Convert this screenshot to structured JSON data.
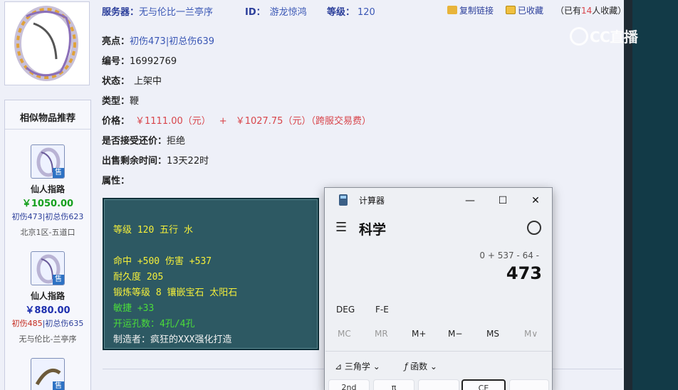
{
  "header": {
    "server_label": "服务器：",
    "server_value": "无与伦比一兰亭序",
    "id_label": "ID：",
    "id_value": "游龙惊鸿",
    "level_label": "等级：",
    "level_value": "120",
    "copy_link": "复制链接",
    "favorited": "已收藏",
    "fav_count_prefix": "（已有",
    "fav_count": "14",
    "fav_count_suffix": "人收藏）"
  },
  "details": {
    "highlight_label": "亮点：",
    "highlight_value": "初伤473|初总伤639",
    "number_label": "编号：",
    "number_value": "16992769",
    "status_label": "状态：",
    "status_value": "上架中",
    "type_label": "类型：",
    "type_value": "鞭",
    "price_label": "价格：",
    "price_value": "￥1111.00（元）",
    "price_plus": "+",
    "price_fee": "￥1027.75（元）（跨服交易费）",
    "bargain_label": "是否接受还价：",
    "bargain_value": "拒绝",
    "remaining_label": "出售剩余时间：",
    "remaining_value": "13天22时",
    "attr_label": "属性："
  },
  "item_info": {
    "line1": "等级 120 五行 水",
    "line2": "命中 +500 伤害 +537",
    "line3": "耐久度 205",
    "line4": "锻炼等级 8 镶嵌宝石 太阳石",
    "line5": "敏捷 +33",
    "line6": "开运孔数：4孔/4孔",
    "line7": "制造者：疯狂的XXX强化打造"
  },
  "recommend": {
    "title": "相似物品推荐",
    "sell_badge": "售",
    "items": [
      {
        "name": "仙人指路",
        "price": "￥1050.00",
        "price_color": "#16a01e",
        "stat_a": "初伤473",
        "stat_sep": "|",
        "stat_b": "初总伤623",
        "server": "北京1区-五道口"
      },
      {
        "name": "仙人指路",
        "price": "￥880.00",
        "price_color": "#1d2fae",
        "stat_a": "初伤485",
        "stat_sep": "|",
        "stat_b": "初总伤635",
        "server": "无与伦比-兰亭序"
      }
    ]
  },
  "watermark": "CC直播",
  "calculator": {
    "title": "计算器",
    "minimize": "—",
    "maximize": "☐",
    "close": "✕",
    "menu_icon": "☰",
    "mode": "科学",
    "expression": "0 + 537 - 64 -",
    "display": "473",
    "deg": "DEG",
    "fe": "F-E",
    "mc": "MC",
    "mr": "MR",
    "mplus": "M+",
    "mminus": "M−",
    "ms": "MS",
    "mv": "M∨",
    "trig": "三角学",
    "func": "函数",
    "key_sq": "2nd",
    "key_pi": "π",
    "key_ce": "CE"
  }
}
